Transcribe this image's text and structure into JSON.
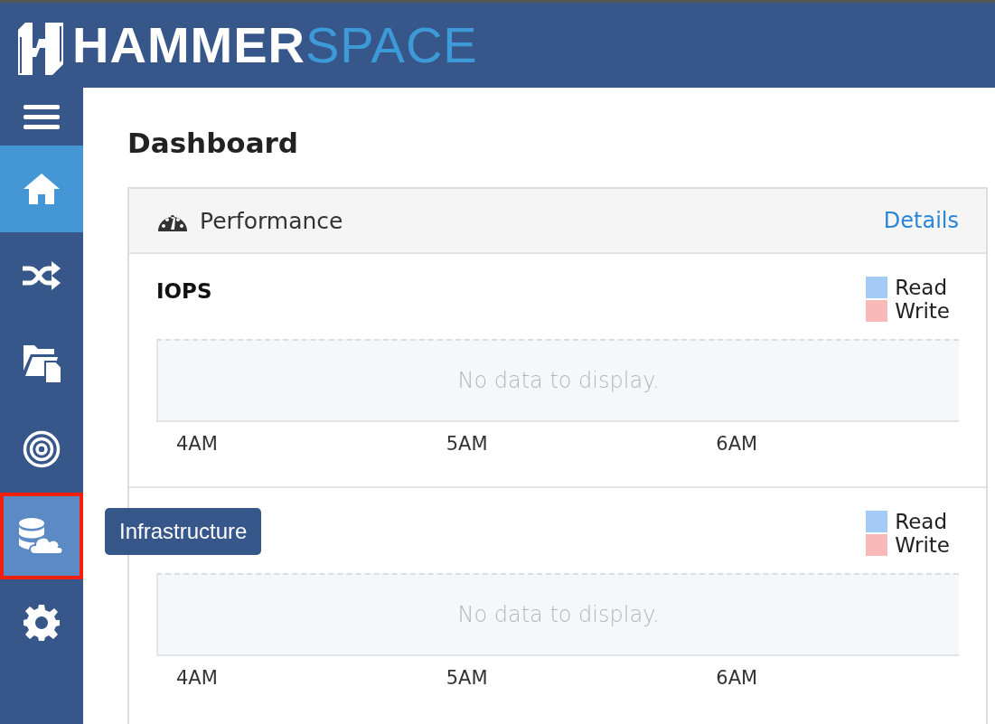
{
  "header": {
    "logo_bold": "HAMMER",
    "logo_light": "SPACE"
  },
  "sidebar": {
    "items": [
      {
        "kind": "menu",
        "selected": false,
        "highlighted": false
      },
      {
        "kind": "home",
        "selected": true,
        "highlighted": false
      },
      {
        "kind": "shuffle",
        "selected": false,
        "highlighted": false
      },
      {
        "kind": "files",
        "selected": false,
        "highlighted": false
      },
      {
        "kind": "target",
        "selected": false,
        "highlighted": false
      },
      {
        "kind": "infrastructure",
        "selected": false,
        "highlighted": true
      },
      {
        "kind": "settings",
        "selected": false,
        "highlighted": false
      }
    ],
    "tooltip": "Infrastructure"
  },
  "page_title": "Dashboard",
  "performance": {
    "title": "Performance",
    "details_link": "Details",
    "charts": [
      {
        "title": "IOPS",
        "legend": [
          {
            "label": "Read",
            "color": "#a3cbf5"
          },
          {
            "label": "Write",
            "color": "#f9b9b9"
          }
        ],
        "empty_message": "No data to display.",
        "x_labels": [
          "4AM",
          "5AM",
          "6AM"
        ]
      },
      {
        "legend": [
          {
            "label": "Read",
            "color": "#a3cbf5"
          },
          {
            "label": "Write",
            "color": "#f9b9b9"
          }
        ],
        "empty_message": "No data to display.",
        "x_labels": [
          "4AM",
          "5AM",
          "6AM"
        ]
      }
    ]
  }
}
